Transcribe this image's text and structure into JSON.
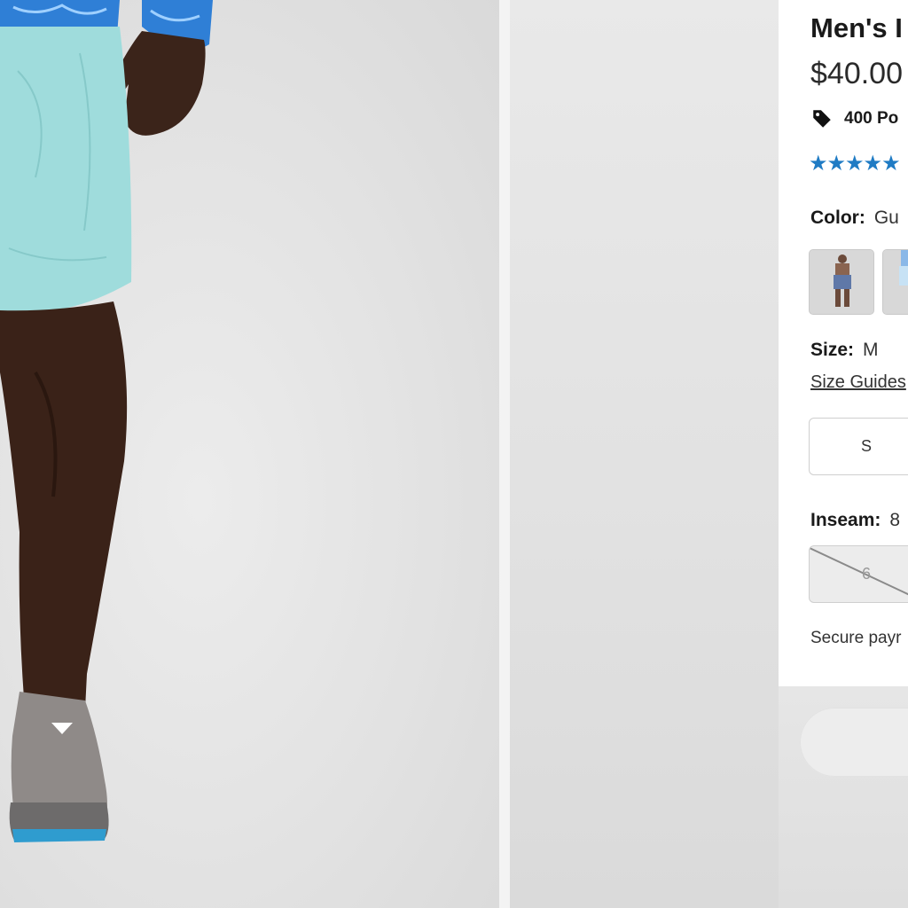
{
  "product": {
    "title": "Men's I",
    "price": "$40.00",
    "points_text": "400 Po",
    "rating_stars": "★★★★★"
  },
  "color": {
    "label": "Color:",
    "value": "Gu"
  },
  "size": {
    "label": "Size:",
    "value": "M",
    "guide_link": "Size Guides",
    "options": [
      {
        "label": "S",
        "available": true
      }
    ]
  },
  "inseam": {
    "label": "Inseam:",
    "value": "8",
    "options": [
      {
        "label": "6",
        "available": false
      }
    ]
  },
  "secure_text": "Secure payr",
  "colors": {
    "accent_star": "#1f7bc4",
    "shorts": "#9fdcdc",
    "shirt": "#2f7fd6"
  }
}
